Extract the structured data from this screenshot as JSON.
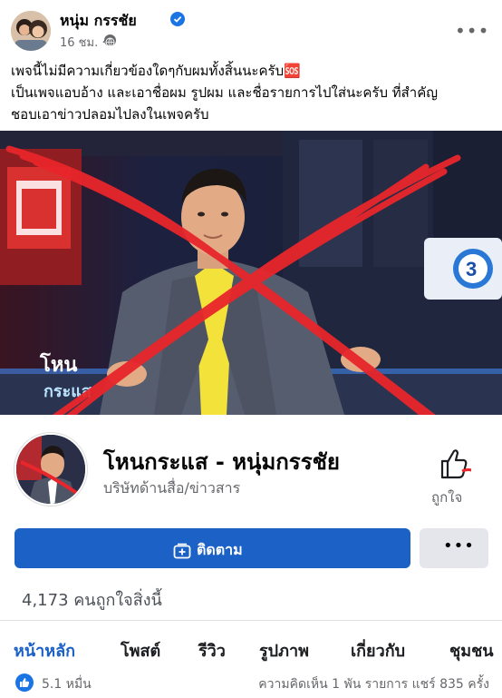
{
  "post": {
    "author": "หนุ่ม กรรชัย",
    "time": "16 ชม. ·",
    "text_lines": [
      "เพจนี้ไม่มีความเกี่ยวข้องใดๆกับผมทั้งสิ้นนะครับ🆘",
      "เป็นเพจแอบอ้าง และเอาชื่อผม รูปผม และชื่อรายการไปใส่นะครับ ที่สำคัญ",
      "ชอบเอาข่าวปลอมไปลงในเพจครับ"
    ],
    "photo_overlay_text": {
      "logo_top": "โหน",
      "logo_bottom": "กระแส",
      "channel": "3"
    }
  },
  "page_card": {
    "name": "โหนกระแส - หนุ่มกรรชัย",
    "category": "บริษัทด้านสื่อ/ข่าวสาร",
    "like_label": "ถูกใจ",
    "follow_label": "ติดตาม",
    "more_label": "•••",
    "likes_count": "4,173 คนถูกใจสิ่งนี้"
  },
  "tabs": [
    "หน้าหลัก",
    "โพสต์",
    "รีวิว",
    "รูปภาพ",
    "เกี่ยวกับ",
    "ชุมชน"
  ],
  "footer": {
    "reactions": "5.1 หมื่น",
    "stats": "ความคิดเห็น 1 พัน รายการ  แชร์ 835 ครั้ง"
  },
  "colors": {
    "accent": "#1b61c6",
    "cross": "#e8262b",
    "verified": "#1b74e4"
  },
  "icons": [
    "verified-badge-icon",
    "globe-icon",
    "more-icon",
    "thumbs-up-icon",
    "follow-add-icon",
    "like-reaction-icon"
  ]
}
